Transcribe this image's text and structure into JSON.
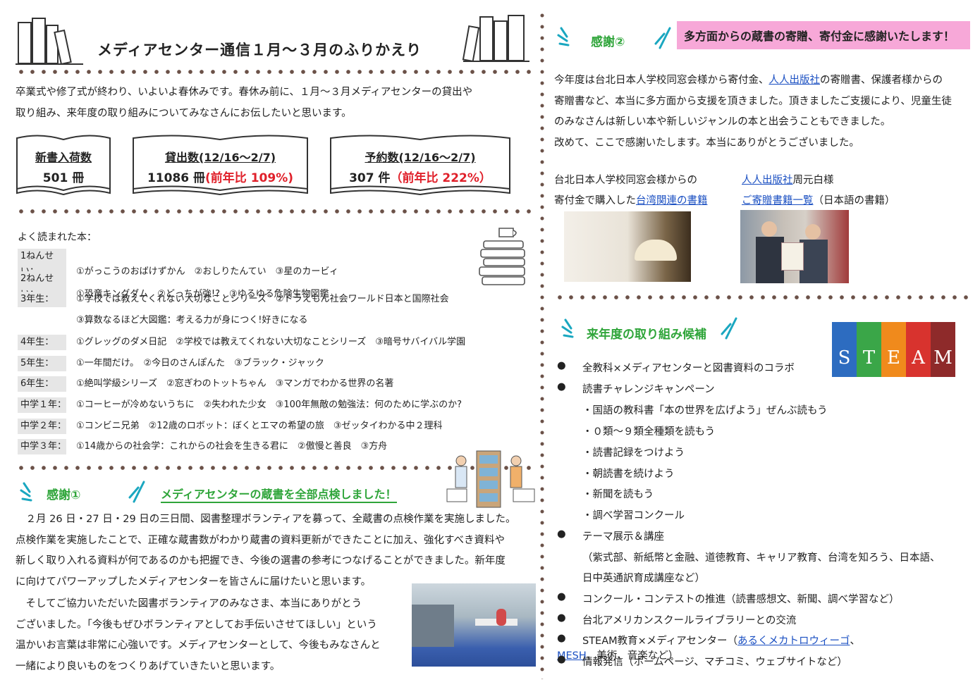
{
  "header": {
    "title": "メディアセンター通信１月〜３月のふりかえり"
  },
  "intro": {
    "line1": "卒業式や修了式が終わり、いよいよ春休みです。春休み前に、１月〜３月メディアセンターの貸出や",
    "line2": "取り組み、来年度の取り組みについてみなさんにお伝したいと思います。"
  },
  "stats": {
    "new_books_label": "新書入荷数",
    "new_books_value": "501 冊",
    "loans_label": "貸出数(12/16〜2/7)",
    "loans_value": "11086 冊",
    "loans_ratio": "(前年比 109%)",
    "reservations_label": "予約数(12/16〜2/7)",
    "reservations_value": "307 件",
    "reservations_ratio": "（前年比 222%）"
  },
  "popular": {
    "heading": "よく読まれた本：",
    "rows": [
      {
        "grade": "1ねんせい：",
        "books": "①がっこうのおばけずかん　②おしりたんてい　③星のカービィ"
      },
      {
        "grade": "2ねんせい：",
        "books": "①恐竜キングダム　②どっちが強!?　③ゆるゆる危険生物図鑑"
      },
      {
        "grade": "3年生：",
        "books": "①学校では教えてくれない大切なことシリーズ　②ドラえもん社会ワールド日本と国際社会"
      },
      {
        "grade": "",
        "books": "③算数なるほど大図鑑：考える力が身につく!好きになる"
      },
      {
        "grade": "4年生：",
        "books": "①グレッグのダメ日記　②学校では教えてくれない大切なことシリーズ　③暗号サバイバル学園"
      },
      {
        "grade": "5年生：",
        "books": "①一年間だけ。　②今日のさんぽんた　③ブラック・ジャック"
      },
      {
        "grade": "6年生：",
        "books": "①絶叫学級シリーズ　②窓ぎわのトットちゃん　③マンガでわかる世界の名著"
      },
      {
        "grade": "中学１年：",
        "books": "①コーヒーが冷めないうちに　②失われた少女　③100年無敵の勉強法：何のために学ぶのか?"
      },
      {
        "grade": "中学２年：",
        "books": "①コンビニ兄弟　②12歳のロボット：ぼくとエマの希望の旅　③ゼッタイわかる中２理科"
      },
      {
        "grade": "中学３年：",
        "books": "①14歳からの社会学：これからの社会を生きる君に　②傲慢と善良　③方舟"
      }
    ]
  },
  "thanks1": {
    "label": "感謝①",
    "headline": "メディアセンターの蔵書を全部点検しました！",
    "p1": [
      "　２月 26 日・27 日・29 日の三日間、図書整理ボランティアを募って、全蔵書の点検作業を実施しました。",
      "点検作業を実施したことで、正確な蔵書数がわかり蔵書の資料更新ができたことに加え、強化すべき資料や",
      "新しく取り入れる資料が何であるのかも把握でき、今後の選書の参考につなげることができました。新年度",
      "に向けてパワーアップしたメディアセンターを皆さんに届けたいと思います。"
    ],
    "p2": [
      "　そしてご協力いただいた図書ボランティアのみなさま、本当にありがとう",
      "ございました。「今後もぜひボランティアとしてお手伝いさせてほしい」という",
      "温かいお言葉は非常に心強いです。メディアセンターとして、今後もみなさんと",
      "一緒により良いものをつくりあげていきたいと思います。"
    ]
  },
  "thanks2": {
    "label": "感謝②",
    "headline": "多方面からの蔵書の寄贈、寄付金に感謝いたします！",
    "l1a": "今年度は台北日本人学校同窓会様から寄付金、",
    "l1link": "人人出版社",
    "l1b": "の寄贈書、保護者様からの",
    "l2": "寄贈書など、本当に多方面から支援を頂きました。頂きましたご支援により、児童生徒",
    "l3": "のみなさんは新しい本や新しいジャンルの本と出会うこともできました。",
    "l4": "改めて、ここで感謝いたします。本当にありがとうございました。",
    "left_caption1": "台北日本人学校同窓会様からの",
    "left_caption2a": "寄付金で購入した",
    "left_caption2link": "台湾関連の書籍",
    "right_caption1link": "人人出版社",
    "right_caption1b": "周元白様",
    "right_caption2link": "ご寄贈書籍一覧",
    "right_caption2b": "（日本語の書籍）"
  },
  "next_year": {
    "headline": "来年度の取り組み候補",
    "steam_letters": [
      "S",
      "T",
      "E",
      "A",
      "M"
    ],
    "items": [
      "全教科×メディアセンターと図書資料のコラボ",
      "読書チャレンジキャンペーン"
    ],
    "sub_items": [
      "・国語の教科書「本の世界を広げよう」ぜんぶ読もう",
      "・０類〜９類全種類を読もう",
      "・読書記録をつけよう",
      "・朝読書を続けよう",
      "・新聞を読もう",
      "・調べ学習コンクール"
    ],
    "theme": "テーマ展示＆講座",
    "theme_detail1": "（紫式部、新紙幣と金融、道徳教育、キャリア教育、台湾を知ろう、日本語、",
    "theme_detail2": "日中英通訳育成講座など）",
    "contest": "コンクール・コンテストの推進（読書感想文、新聞、調べ学習など）",
    "exchange": "台北アメリカンスクールライブラリーとの交流",
    "steam_a": "STEAM教育×メディアセンター（",
    "steam_link1": "あるくメカトロウィーゴ",
    "steam_sep": "、",
    "steam_link2": "MESH",
    "steam_b": "、美術、音楽など）",
    "info": "情報発信（ホームページ、マチコミ、ウェブサイトなど）"
  },
  "colors": {
    "accent_green": "#2fa53a",
    "pink": "#f7a8d8",
    "red": "#e0202a",
    "link": "#1a4fc2"
  }
}
